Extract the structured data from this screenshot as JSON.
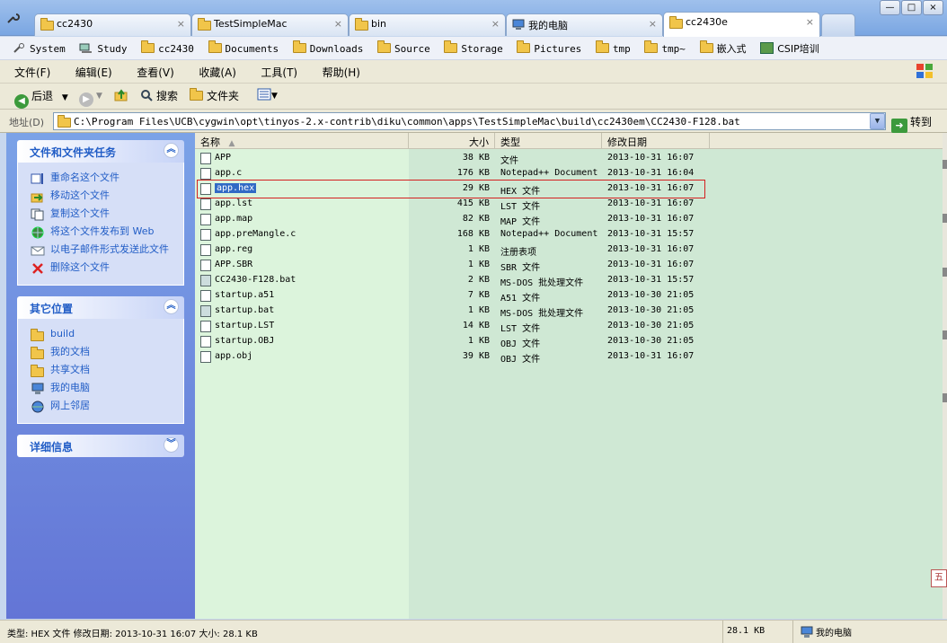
{
  "tabs": [
    {
      "label": "cc2430",
      "close": "×"
    },
    {
      "label": "TestSimpleMac",
      "close": "×"
    },
    {
      "label": "bin",
      "close": "×"
    },
    {
      "label": "我的电脑",
      "close": "×"
    },
    {
      "label": "cc2430e",
      "close": "×"
    }
  ],
  "window_controls": {
    "minimize": "—",
    "maximize": "□",
    "close": "×"
  },
  "bookmarks": [
    "System",
    "Study",
    "cc2430",
    "Documents",
    "Downloads",
    "Source",
    "Storage",
    "Pictures",
    "tmp",
    "tmp~",
    "嵌入式",
    "CSIP培训"
  ],
  "menu": [
    "文件(F)",
    "编辑(E)",
    "查看(V)",
    "收藏(A)",
    "工具(T)",
    "帮助(H)"
  ],
  "toolbar": {
    "back": "后退",
    "search": "搜索",
    "folders": "文件夹"
  },
  "address": {
    "label": "地址(D)",
    "path": "C:\\Program Files\\UCB\\cygwin\\opt\\tinyos-2.x-contrib\\diku\\common\\apps\\TestSimpleMac\\build\\cc2430em\\CC2430-F128.bat",
    "go": "转到"
  },
  "tasks_panel": {
    "title": "文件和文件夹任务",
    "items": [
      "重命名这个文件",
      "移动这个文件",
      "复制这个文件",
      "将这个文件发布到 Web",
      "以电子邮件形式发送此文件",
      "删除这个文件"
    ]
  },
  "places_panel": {
    "title": "其它位置",
    "items": [
      "build",
      "我的文档",
      "共享文档",
      "我的电脑",
      "网上邻居"
    ]
  },
  "details_panel": {
    "title": "详细信息"
  },
  "columns": {
    "name": "名称",
    "size": "大小",
    "type": "类型",
    "modified": "修改日期"
  },
  "files": [
    {
      "name": "APP",
      "size": "38 KB",
      "type": "文件",
      "modified": "2013-10-31 16:07"
    },
    {
      "name": "app.c",
      "size": "176 KB",
      "type": "Notepad++ Document",
      "modified": "2013-10-31 16:04"
    },
    {
      "name": "app.hex",
      "size": "29 KB",
      "type": "HEX 文件",
      "modified": "2013-10-31 16:07"
    },
    {
      "name": "app.lst",
      "size": "415 KB",
      "type": "LST 文件",
      "modified": "2013-10-31 16:07"
    },
    {
      "name": "app.map",
      "size": "82 KB",
      "type": "MAP 文件",
      "modified": "2013-10-31 16:07"
    },
    {
      "name": "app.preMangle.c",
      "size": "168 KB",
      "type": "Notepad++ Document",
      "modified": "2013-10-31 15:57"
    },
    {
      "name": "app.reg",
      "size": "1 KB",
      "type": "注册表项",
      "modified": "2013-10-31 16:07"
    },
    {
      "name": "APP.SBR",
      "size": "1 KB",
      "type": "SBR 文件",
      "modified": "2013-10-31 16:07"
    },
    {
      "name": "CC2430-F128.bat",
      "size": "2 KB",
      "type": "MS-DOS 批处理文件",
      "modified": "2013-10-31 15:57"
    },
    {
      "name": "startup.a51",
      "size": "7 KB",
      "type": "A51 文件",
      "modified": "2013-10-30 21:05"
    },
    {
      "name": "startup.bat",
      "size": "1 KB",
      "type": "MS-DOS 批处理文件",
      "modified": "2013-10-30 21:05"
    },
    {
      "name": "startup.LST",
      "size": "14 KB",
      "type": "LST 文件",
      "modified": "2013-10-30 21:05"
    },
    {
      "name": "startup.OBJ",
      "size": "1 KB",
      "type": "OBJ 文件",
      "modified": "2013-10-30 21:05"
    },
    {
      "name": "app.obj",
      "size": "39 KB",
      "type": "OBJ 文件",
      "modified": "2013-10-31 16:07"
    }
  ],
  "selected_file": "app.hex",
  "status": {
    "info": "类型: HEX 文件 修改日期: 2013-10-31 16:07 大小: 28.1 KB",
    "size": "28.1 KB",
    "location": "我的电脑"
  },
  "side_tag": "五",
  "colors": {
    "selection": "#316ac5",
    "highlight_box": "#d42020",
    "task_link": "#215dc6"
  }
}
